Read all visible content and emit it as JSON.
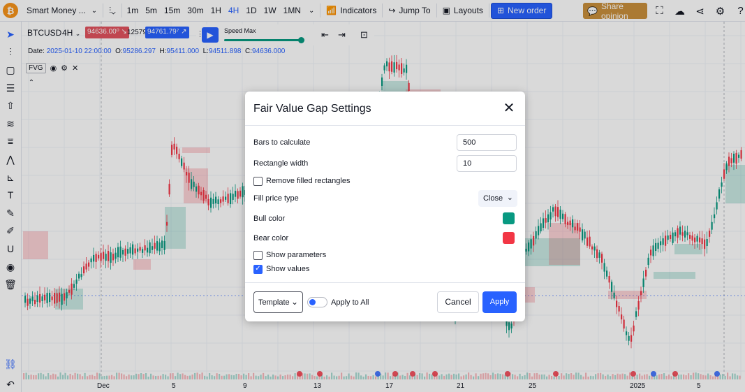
{
  "topbar": {
    "logo": "₿",
    "symbol_search": "Smart Money ...",
    "timeframes": [
      "1m",
      "5m",
      "15m",
      "30m",
      "1H",
      "4H",
      "1D",
      "1W",
      "1MN"
    ],
    "active_timeframe": "4H",
    "indicators": "Indicators",
    "jump_to": "Jump To",
    "layouts": "Layouts",
    "new_order": "New order",
    "share_opinion": "Share opinion"
  },
  "legend": {
    "symbol": "BTCUSD",
    "timeframe": "4H",
    "bid": "94636.00⁰",
    "spread": "125797",
    "ask": "94761.79⁷",
    "date_label": "Date:",
    "date": "2025-01-10 22:00:00",
    "open_label": "O:",
    "open": "95286.297",
    "high_label": "H:",
    "high": "95411.000",
    "low_label": "L:",
    "low": "94511.898",
    "close_label": "C:",
    "close": "94636.000",
    "indicator": "FVG"
  },
  "replay": {
    "speed_label": "Speed Max",
    "speed_value": 0.96
  },
  "x_axis": {
    "labels": [
      "Dec",
      "5",
      "9",
      "13",
      "17",
      "21",
      "25",
      "2025",
      "5"
    ]
  },
  "dialog": {
    "title": "Fair Value Gap Settings",
    "bars_label": "Bars to calculate",
    "bars_value": "500",
    "rect_width_label": "Rectangle width",
    "rect_width_value": "10",
    "remove_filled_label": "Remove filled rectangles",
    "remove_filled_checked": false,
    "fill_price_label": "Fill price type",
    "fill_price_value": "Close",
    "bull_color_label": "Bull color",
    "bull_color": "#089981",
    "bear_color_label": "Bear color",
    "bear_color": "#f23645",
    "show_params_label": "Show parameters",
    "show_params_checked": false,
    "show_values_label": "Show values",
    "show_values_checked": true,
    "template_label": "Template",
    "apply_all_label": "Apply to All",
    "cancel_label": "Cancel",
    "apply_label": "Apply"
  },
  "colors": {
    "accent": "#2962ff",
    "bull": "#089981",
    "bear": "#f23645"
  }
}
